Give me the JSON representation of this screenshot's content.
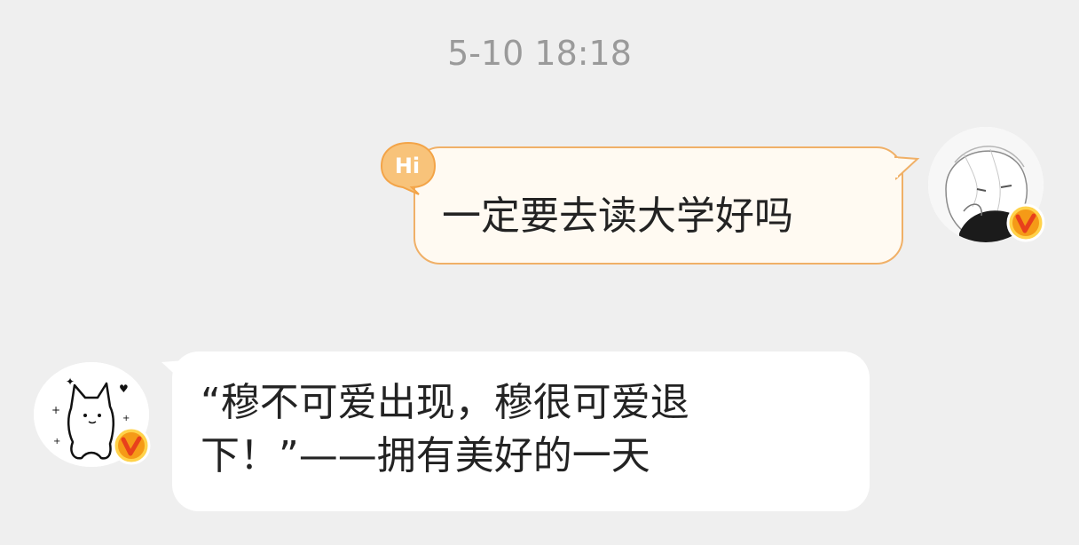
{
  "chat": {
    "timestamp": "5-10 18:18",
    "messages": [
      {
        "direction": "outgoing",
        "badge": "Hi",
        "text": "一定要去读大学好吗"
      },
      {
        "direction": "incoming",
        "lines": [
          "“穆不可爱出现，穆很可爱退",
          "下！”——拥有美好的一天"
        ]
      }
    ],
    "vip_badge_letter": "v"
  },
  "colors": {
    "background": "#efefef",
    "outgoing_bubble": "#fffaf2",
    "outgoing_border": "#f0b067",
    "incoming_bubble": "#ffffff",
    "vip_badge": "#f7a51c"
  }
}
